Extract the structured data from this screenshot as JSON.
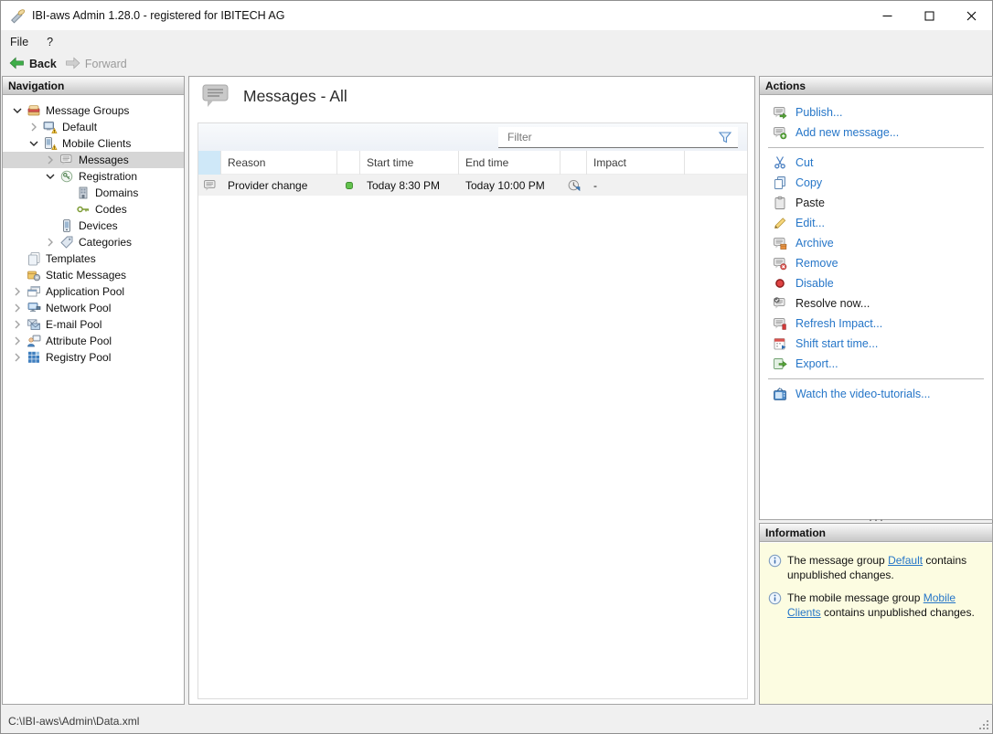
{
  "window": {
    "title": "IBI-aws Admin 1.28.0 - registered for IBITECH AG"
  },
  "menu": {
    "items": [
      "File",
      "?"
    ]
  },
  "toolbar": {
    "back_label": "Back",
    "forward_label": "Forward"
  },
  "navigation": {
    "header": "Navigation",
    "items": [
      {
        "label": "Message Groups",
        "level": 0,
        "expand": "open",
        "icon": "message-groups-icon",
        "selected": false
      },
      {
        "label": "Default",
        "level": 1,
        "expand": "closed",
        "icon": "default-group-icon",
        "selected": false
      },
      {
        "label": "Mobile Clients",
        "level": 1,
        "expand": "open",
        "icon": "mobile-clients-icon",
        "selected": false
      },
      {
        "label": "Messages",
        "level": 2,
        "expand": "closed",
        "icon": "messages-icon",
        "selected": true
      },
      {
        "label": "Registration",
        "level": 2,
        "expand": "open",
        "icon": "registration-icon",
        "selected": false
      },
      {
        "label": "Domains",
        "level": 3,
        "expand": "none",
        "icon": "domains-icon",
        "selected": false
      },
      {
        "label": "Codes",
        "level": 3,
        "expand": "none",
        "icon": "codes-icon",
        "selected": false
      },
      {
        "label": "Devices",
        "level": 2,
        "expand": "none",
        "icon": "devices-icon",
        "selected": false
      },
      {
        "label": "Categories",
        "level": 2,
        "expand": "closed",
        "icon": "categories-icon",
        "selected": false
      },
      {
        "label": "Templates",
        "level": 0,
        "expand": "none",
        "icon": "templates-icon",
        "selected": false
      },
      {
        "label": "Static Messages",
        "level": 0,
        "expand": "none",
        "icon": "static-messages-icon",
        "selected": false
      },
      {
        "label": "Application Pool",
        "level": 0,
        "expand": "closed",
        "icon": "application-pool-icon",
        "selected": false
      },
      {
        "label": "Network Pool",
        "level": 0,
        "expand": "closed",
        "icon": "network-pool-icon",
        "selected": false
      },
      {
        "label": "E-mail Pool",
        "level": 0,
        "expand": "closed",
        "icon": "email-pool-icon",
        "selected": false
      },
      {
        "label": "Attribute Pool",
        "level": 0,
        "expand": "closed",
        "icon": "attribute-pool-icon",
        "selected": false
      },
      {
        "label": "Registry Pool",
        "level": 0,
        "expand": "closed",
        "icon": "registry-pool-icon",
        "selected": false
      }
    ]
  },
  "main": {
    "title": "Messages - All",
    "filter_placeholder": "Filter",
    "table": {
      "columns": [
        "",
        "Reason",
        "",
        "Start time",
        "End time",
        "",
        "Impact"
      ],
      "rows": [
        {
          "reason": "Provider change",
          "status": "active",
          "start_time": "Today 8:30 PM",
          "end_time": "Today 10:00 PM",
          "impact": "-"
        }
      ]
    }
  },
  "actions": {
    "header": "Actions",
    "items": [
      {
        "label": "Publish...",
        "icon": "publish-icon",
        "enabled": true,
        "separator_after": false
      },
      {
        "label": "Add new message...",
        "icon": "add-message-icon",
        "enabled": true,
        "separator_after": true
      },
      {
        "label": "Cut",
        "icon": "cut-icon",
        "enabled": true,
        "separator_after": false
      },
      {
        "label": "Copy",
        "icon": "copy-icon",
        "enabled": true,
        "separator_after": false
      },
      {
        "label": "Paste",
        "icon": "paste-icon",
        "enabled": false,
        "separator_after": false
      },
      {
        "label": "Edit...",
        "icon": "edit-icon",
        "enabled": true,
        "separator_after": false
      },
      {
        "label": "Archive",
        "icon": "archive-icon",
        "enabled": true,
        "separator_after": false
      },
      {
        "label": "Remove",
        "icon": "remove-icon",
        "enabled": true,
        "separator_after": false
      },
      {
        "label": "Disable",
        "icon": "disable-icon",
        "enabled": true,
        "separator_after": false
      },
      {
        "label": "Resolve now...",
        "icon": "resolve-icon",
        "enabled": false,
        "separator_after": false
      },
      {
        "label": "Refresh Impact...",
        "icon": "refresh-impact-icon",
        "enabled": true,
        "separator_after": false
      },
      {
        "label": "Shift start time...",
        "icon": "shift-start-icon",
        "enabled": true,
        "separator_after": false
      },
      {
        "label": "Export...",
        "icon": "export-icon",
        "enabled": true,
        "separator_after": true
      },
      {
        "label": "Watch the video-tutorials...",
        "icon": "video-tutorials-icon",
        "enabled": true,
        "separator_after": false
      }
    ]
  },
  "information": {
    "header": "Information",
    "items": [
      {
        "prefix": "The message group ",
        "link": "Default",
        "suffix": " contains unpublished changes."
      },
      {
        "prefix": "The mobile message group ",
        "link": "Mobile Clients",
        "suffix": " contains unpublished changes."
      }
    ]
  },
  "statusbar": {
    "path": "C:\\IBI-aws\\Admin\\Data.xml"
  },
  "colors": {
    "link": "#2676c8",
    "info_bg": "#fcfce1",
    "selected_row": "#d6d6d6",
    "header_sel_col": "#cfe8f8",
    "status_green": "#63c24e",
    "back_green": "#3fae49"
  }
}
